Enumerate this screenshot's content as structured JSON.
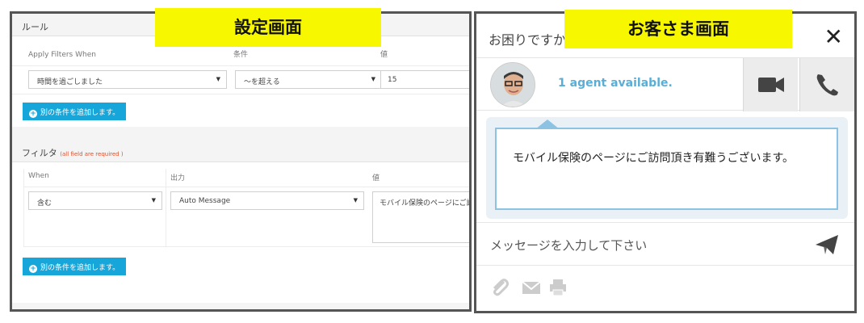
{
  "settings": {
    "banner": "設定画面",
    "rules": {
      "header": "ルール",
      "columns": [
        "Apply Filters When",
        "条件",
        "値"
      ],
      "when_value": "時間を過ごしました",
      "condition_value": "〜を超える",
      "number_value": "15",
      "add_button": "別の条件を追加します。"
    },
    "filter": {
      "header": "フィルタ",
      "required_note": "(all field are required )",
      "columns": [
        "When",
        "出力",
        "値"
      ],
      "when_value": "含む",
      "output_value": "Auto Message",
      "message_value": "モバイル保険のページにご訪",
      "add_button": "別の条件を追加します。"
    }
  },
  "chat": {
    "banner": "お客さま画面",
    "title": "お困りですか",
    "close_icon": "close-icon",
    "agent_status": "1 agent available.",
    "message": "モバイル保険のページにご訪問頂き有難うございます。",
    "input_placeholder": "メッセージを入力して下さい",
    "icons": [
      "video-icon",
      "phone-icon",
      "send-icon",
      "attach-icon",
      "mail-icon",
      "print-icon"
    ],
    "colors": {
      "accent": "#5aaed6",
      "bubble_border": "#8cc3e3",
      "button": "#17a6d9",
      "banner": "#f7f700"
    }
  }
}
